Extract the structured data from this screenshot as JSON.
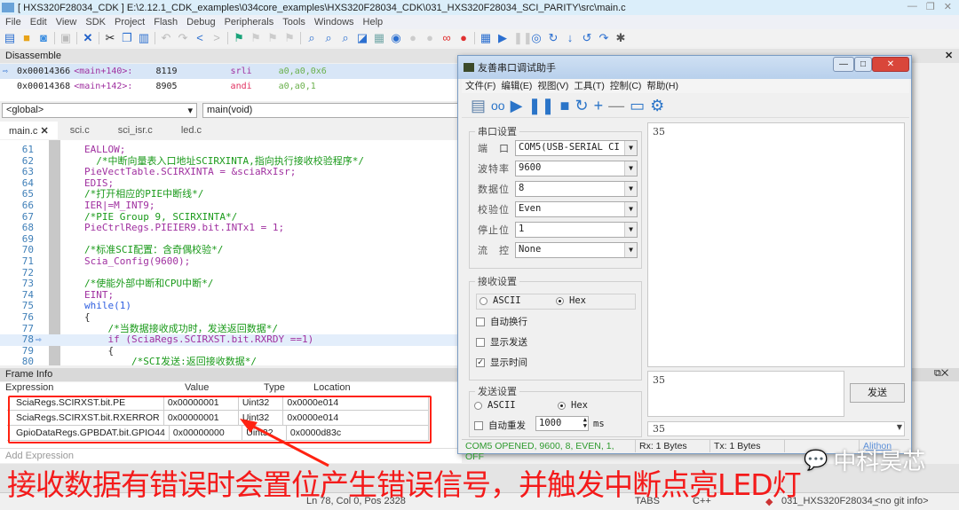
{
  "ide": {
    "title": "[ HXS320F28034_CDK ] E:\\2.12.1_CDK_examples\\034core_examples\\HXS320F28034_CDK\\031_HXS320F28034_SCI_PARITY\\src\\main.c",
    "menu": [
      "File",
      "Edit",
      "View",
      "SDK",
      "Project",
      "Flash",
      "Debug",
      "Peripherals",
      "Tools",
      "Windows",
      "Help"
    ],
    "disassemble": {
      "header": "Disassemble",
      "rows": [
        {
          "addr": "0x00014366",
          "sym": "<main+140>:",
          "code": "8119",
          "op": "srli",
          "args": "a0,a0,0x6"
        },
        {
          "addr": "0x00014368",
          "sym": "<main+142>:",
          "code": "8905",
          "op": "andi",
          "args": "a0,a0,1"
        }
      ]
    },
    "scope_combo": "<global>",
    "function_combo": "main(void)",
    "tabs": [
      "main.c",
      "sci.c",
      "sci_isr.c",
      "led.c"
    ],
    "code": [
      {
        "n": "61",
        "t": "EALLOW;",
        "c": "m"
      },
      {
        "n": "62",
        "t": "  /*中断向量表入口地址SCIRXINTA,指向执行接收校验程序*/",
        "c": "g"
      },
      {
        "n": "63",
        "t": "PieVectTable.SCIRXINTA = &sciaRxIsr;",
        "c": "m"
      },
      {
        "n": "64",
        "t": "EDIS;",
        "c": "m"
      },
      {
        "n": "65",
        "t": "/*打开相应的PIE中断线*/",
        "c": "g"
      },
      {
        "n": "66",
        "t": "IER|=M_INT9;",
        "c": "m"
      },
      {
        "n": "67",
        "t": "/*PIE Group 9, SCIRXINTA*/",
        "c": "g"
      },
      {
        "n": "68",
        "t": "PieCtrlRegs.PIEIER9.bit.INTx1 = 1;",
        "c": "m"
      },
      {
        "n": "69",
        "t": "",
        "c": "t"
      },
      {
        "n": "70",
        "t": "/*标准SCI配置：含奇偶校验*/",
        "c": "g"
      },
      {
        "n": "71",
        "t": "Scia_Config(9600);",
        "c": "m"
      },
      {
        "n": "72",
        "t": "",
        "c": "t"
      },
      {
        "n": "73",
        "t": "/*使能外部中断和CPU中断*/",
        "c": "g"
      },
      {
        "n": "74",
        "t": "EINT;",
        "c": "m"
      },
      {
        "n": "75",
        "t": "while(1)",
        "c": "k"
      },
      {
        "n": "76",
        "t": "{",
        "c": "t"
      },
      {
        "n": "77",
        "t": "    /*当数据接收成功时，发送返回数据*/",
        "c": "g"
      },
      {
        "n": "78",
        "t": "    if (SciaRegs.SCIRXST.bit.RXRDY ==1)",
        "c": "m"
      },
      {
        "n": "79",
        "t": "    {",
        "c": "t"
      },
      {
        "n": "80",
        "t": "        /*SCI发送:返回接收数据*/",
        "c": "g"
      }
    ],
    "frame_info": {
      "header": "Frame Info",
      "columns": [
        "Expression",
        "Value",
        "Type",
        "Location"
      ],
      "rows": [
        [
          "SciaRegs.SCIRXST.bit.PE",
          "0x00000001",
          "Uint32",
          "0x0000e014"
        ],
        [
          "SciaRegs.SCIRXST.bit.RXERROR",
          "0x00000001",
          "Uint32",
          "0x0000e014"
        ],
        [
          "GpioDataRegs.GPBDAT.bit.GPIO44",
          "0x00000000",
          "Uint32",
          "0x0000d83c"
        ]
      ],
      "add_expression": "Add Expression"
    },
    "status": {
      "position": "Ln 78, Col 0, Pos 2328",
      "tabs": "TABS",
      "lang": "C++",
      "project": "031_HXS320F28034_",
      "git": "<no git info>"
    }
  },
  "serial": {
    "title": "友善串口调试助手",
    "menu": [
      "文件(F)",
      "编辑(E)",
      "视图(V)",
      "工具(T)",
      "控制(C)",
      "帮助(H)"
    ],
    "port_settings": {
      "legend": "串口设置",
      "fields": [
        {
          "label": "端　口",
          "value": "COM5(USB-SERIAL CI"
        },
        {
          "label": "波特率",
          "value": "9600"
        },
        {
          "label": "数据位",
          "value": "8"
        },
        {
          "label": "校验位",
          "value": "Even"
        },
        {
          "label": "停止位",
          "value": "1"
        },
        {
          "label": "流　控",
          "value": "None"
        }
      ]
    },
    "recv_settings": {
      "legend": "接收设置",
      "ascii": "ASCII",
      "hex": "Hex",
      "mode": "Hex",
      "checks": [
        {
          "label": "自动换行",
          "checked": false
        },
        {
          "label": "显示发送",
          "checked": false
        },
        {
          "label": "显示时间",
          "checked": true
        }
      ]
    },
    "send_settings": {
      "legend": "发送设置",
      "ascii": "ASCII",
      "hex": "Hex",
      "mode": "Hex",
      "auto_resend": "自动重发",
      "auto_resend_checked": false,
      "interval": "1000",
      "unit": "ms"
    },
    "receive_text": "35",
    "send_text": "35",
    "send_button": "发送",
    "history_combo": "35",
    "statusbar": {
      "conn": "COM5 OPENED, 9600, 8, EVEN, 1, OFF",
      "rx": "Rx: 1 Bytes",
      "tx": "Tx: 1 Bytes",
      "brand": "Alithon"
    }
  },
  "annotation": "接收数据有错误时会置位产生错误信号，并触发中断点亮LED灯",
  "watermark": "中科昊芯",
  "colors": {
    "annotation": "#f41a1a",
    "status_ok": "#2e9a2e",
    "keyword": "#3060e0",
    "macro": "#a030a0",
    "comment": "#1a9a1a"
  }
}
